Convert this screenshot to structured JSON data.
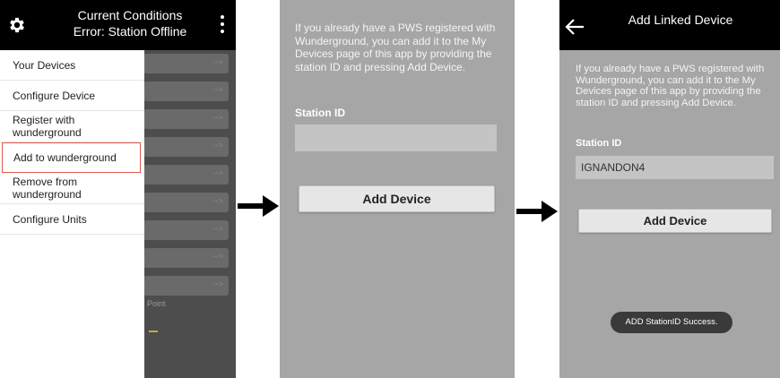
{
  "panel1": {
    "header": {
      "title_line1": "Current Conditions",
      "title_line2": "Error: Station Offline",
      "settings_icon": "gear-icon",
      "overflow_icon": "kebab-menu-icon"
    },
    "drawer": {
      "items": [
        {
          "label": "Your Devices"
        },
        {
          "label": "Configure Device"
        },
        {
          "label": "Register with wunderground"
        },
        {
          "label": "Add to wunderground",
          "selected": true
        },
        {
          "label": "Remove from wunderground"
        },
        {
          "label": "Configure Units"
        }
      ]
    },
    "background": {
      "row_arrow": "-->",
      "point_label": "Point"
    }
  },
  "panel2": {
    "description": "If you already have a PWS registered with Wunderground, you can add it to the My Devices page of this app by providing the station ID and pressing Add Device.",
    "station_id_label": "Station ID",
    "station_id_value": "",
    "add_button_label": "Add Device"
  },
  "panel3": {
    "header": {
      "title": "Add Linked Device",
      "back_icon": "back-arrow-icon"
    },
    "description": "If you already have a PWS registered with Wunderground, you can add it to the My Devices page of this app by providing the station ID and pressing Add Device.",
    "station_id_label": "Station ID",
    "station_id_value": "IGNANDON4",
    "add_button_label": "Add Device",
    "toast": "ADD StationID Success."
  },
  "colors": {
    "header_bg": "#000000",
    "panel_bg": "#a6a6a6",
    "selection_border": "#e05a4e"
  }
}
